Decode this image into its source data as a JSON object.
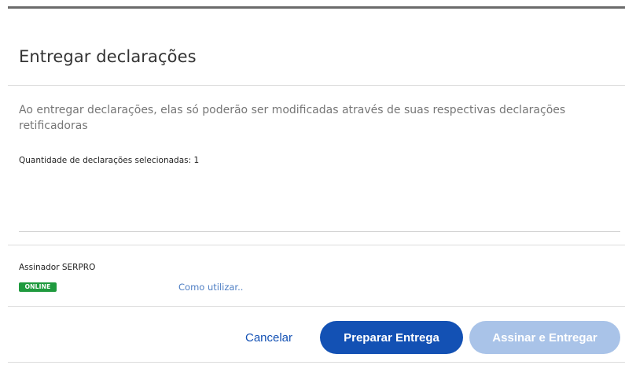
{
  "dialog": {
    "title": "Entregar declarações",
    "description": "Ao entregar declarações, elas só poderão ser modificadas através de suas respectivas declarações retificadoras",
    "count_text": "Quantidade de declarações selecionadas: 1"
  },
  "signer": {
    "label": "Assinador SERPRO",
    "status_badge": "ONLINE",
    "status_color": "#1f9a3e",
    "how_to_link": "Como utilizar.."
  },
  "actions": {
    "cancel_label": "Cancelar",
    "prepare_label": "Preparar Entrega",
    "sign_label": "Assinar e Entregar",
    "primary_color": "#1351b4",
    "disabled_color": "#a9c3e8"
  }
}
